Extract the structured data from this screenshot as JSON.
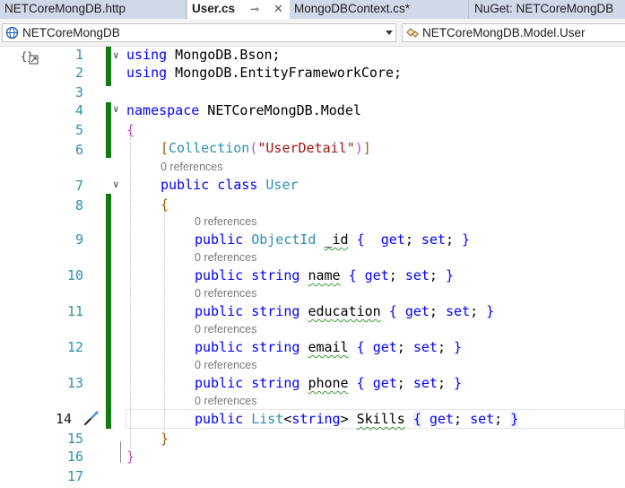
{
  "tabs": [
    {
      "label": "NETCoreMongDB.http",
      "active": false
    },
    {
      "label": "User.cs",
      "active": true,
      "pin_icon": "pin-icon",
      "close_icon": "close-icon"
    },
    {
      "label": "MongoDBContext.cs*",
      "active": false
    },
    {
      "label": "NuGet: NETCoreMongDB",
      "active": false
    }
  ],
  "nav": {
    "project": "NETCoreMongDB",
    "type_member": "NETCoreMongDB.Model.User"
  },
  "line_numbers": [
    "1",
    "2",
    "3",
    "4",
    "5",
    "6",
    "7",
    "8",
    "9",
    "10",
    "11",
    "12",
    "13",
    "14",
    "15",
    "16",
    "17"
  ],
  "current_line": "14",
  "references_label": "0 references",
  "code": {
    "l1_kw": "using",
    "l1_ns": " MongoDB.Bson;",
    "l2_kw": "using",
    "l2_ns": " MongoDB.EntityFrameworkCore;",
    "l4_kw": "namespace",
    "l4_ns": " NETCoreMongDB.Model",
    "l5": "{",
    "l6_open": "[",
    "l6_attr": "Collection",
    "l6_paren1": "(",
    "l6_str": "\"UserDetail\"",
    "l6_paren2": ")",
    "l6_close": "]",
    "l7_kw": "public class",
    "l7_type": "User",
    "l8": "{",
    "l9_kw": "public",
    "l9_type": "ObjectId",
    "l9_name": "_id",
    "l10_kw": "public string",
    "l10_name": "name",
    "l11_kw": "public string",
    "l11_name": "education",
    "l12_kw": "public string",
    "l12_name": "email",
    "l13_kw": "public string",
    "l13_name": "phone",
    "l14_kw": "public",
    "l14_type": "List",
    "l14_lt": "<",
    "l14_kw2": "string",
    "l14_gt": ">",
    "l14_name": "Skills",
    "l15": "}",
    "l16": "}",
    "ob": "{",
    "cb": "}",
    "get": "get",
    "set": "set",
    "semi": ";"
  },
  "colors": {
    "keyword": "#0000ff",
    "type": "#2b91af",
    "string": "#a31515",
    "change_bar": "#107c10"
  }
}
